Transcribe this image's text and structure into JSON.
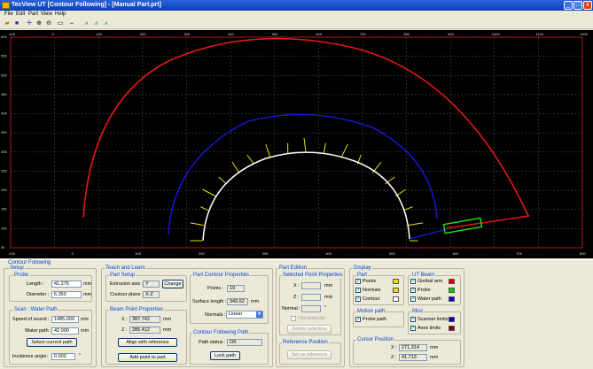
{
  "window": {
    "title": "TecView UT [Contour Following] - [Manual Part.prt]",
    "controls": [
      "_",
      "□",
      "x"
    ]
  },
  "menu": [
    "File",
    "Edit",
    "Part",
    "View",
    "Help"
  ],
  "toolbar": {
    "icons": [
      "open-icon",
      "save-icon",
      "crosshair-icon",
      "zoom-in-icon",
      "zoom-out-icon",
      "zoom-fit-icon",
      "measure-icon",
      "path-icon-1",
      "path-icon-2",
      "path-icon-3"
    ]
  },
  "viewport": {
    "top_ticks": [
      "-100",
      "0",
      "100",
      "200",
      "300",
      "400",
      "500",
      "600",
      "700",
      "800",
      "900",
      "1000",
      "1100",
      "1200"
    ],
    "left_ticks": [
      "600",
      "550",
      "500",
      "450",
      "400",
      "350",
      "300",
      "250",
      "200",
      "150",
      "100",
      "50"
    ],
    "bottom_ticks": [
      "-100",
      "0",
      "100",
      "200",
      "300",
      "400",
      "500",
      "600",
      "700",
      "800"
    ],
    "colors": {
      "gimbal": "#ff2020",
      "probe_path": "#2020ff",
      "contour": "#ffffff",
      "normals": "#f0e000",
      "probe": "#20e020"
    }
  },
  "panel": {
    "title": "Contour Following",
    "setup": {
      "title": "Setup",
      "probe": {
        "title": "Probe",
        "length_label": "Length :",
        "length": "41.275",
        "length_unit": "mm",
        "diameter_label": "Diameter :",
        "diameter": "6.350",
        "diameter_unit": "mm"
      },
      "scan": {
        "title": "Scan : Water Path",
        "speed_label": "Speed of sound :",
        "speed": "1485.000",
        "speed_unit": "m/s",
        "water_label": "Water path :",
        "water": "42.000",
        "water_unit": "mm",
        "select_btn": "Select current path",
        "incidence_label": "Incidence angle:",
        "incidence": "0.000",
        "incidence_unit": "°"
      }
    },
    "teach": {
      "title": "Teach and Learn",
      "part_setup": {
        "title": "Part Setup",
        "extrusion_label": "Extrusion axis :",
        "extrusion": "Y",
        "change_btn": "Change",
        "plane_label": "Coutour plane :",
        "plane": "X-Z"
      },
      "beam": {
        "title": "Beam Point Properties",
        "x_label": "X :",
        "x": "387.742",
        "x_unit": "mm",
        "z_label": "Z :",
        "z": "285.412",
        "z_unit": "mm",
        "align_btn": "Align with reference",
        "add_btn": "Add point to part"
      },
      "contour": {
        "title": "Part Contour Properties",
        "points_label": "Points :",
        "points": "19",
        "surface_label": "Surface length :",
        "surface": "349.62",
        "surface_unit": "mm",
        "normals_label": "Normals :",
        "normals": "Linear"
      },
      "cfpath": {
        "title": "Contour Following Path",
        "status_label": "Path status :",
        "status": "OK",
        "lock_btn": "Lock path"
      }
    },
    "edition": {
      "title": "Part Edition",
      "selected": {
        "title": "Selected Point Properties",
        "x_label": "X :",
        "z_label": "Z :",
        "normal_label": "Normal :",
        "unit_mm": "mm",
        "unit_deg": "°",
        "disc_label": "Discontinuity",
        "delete_btn": "Delete selection"
      },
      "reference": {
        "title": "Reference Position",
        "set_btn": "Set as reference"
      }
    },
    "display": {
      "title": "Display",
      "part": {
        "title": "Part",
        "items": [
          {
            "label": "Points",
            "color": "#f0e000"
          },
          {
            "label": "Normals",
            "color": "#f0e000"
          },
          {
            "label": "Contour",
            "color": "#ffffff"
          }
        ]
      },
      "beam": {
        "title": "UT Beam",
        "items": [
          {
            "label": "Gimbal arm",
            "color": "#e00000"
          },
          {
            "label": "Probe",
            "color": "#00d000"
          },
          {
            "label": "Water path",
            "color": "#0000e0"
          }
        ]
      },
      "motion": {
        "title": "Motion path",
        "items": [
          {
            "label": "Probe path"
          }
        ]
      },
      "misc": {
        "title": "Misc",
        "items": [
          {
            "label": "Scanner limits",
            "color": "#0000c0"
          },
          {
            "label": "Axes limits",
            "color": "#800000"
          }
        ]
      },
      "cursor": {
        "title": "Cursor Position",
        "x_label": "X :",
        "x": "271.314",
        "x_unit": "mm",
        "z_label": "Z :",
        "z": "41.713",
        "z_unit": "mm"
      }
    }
  }
}
